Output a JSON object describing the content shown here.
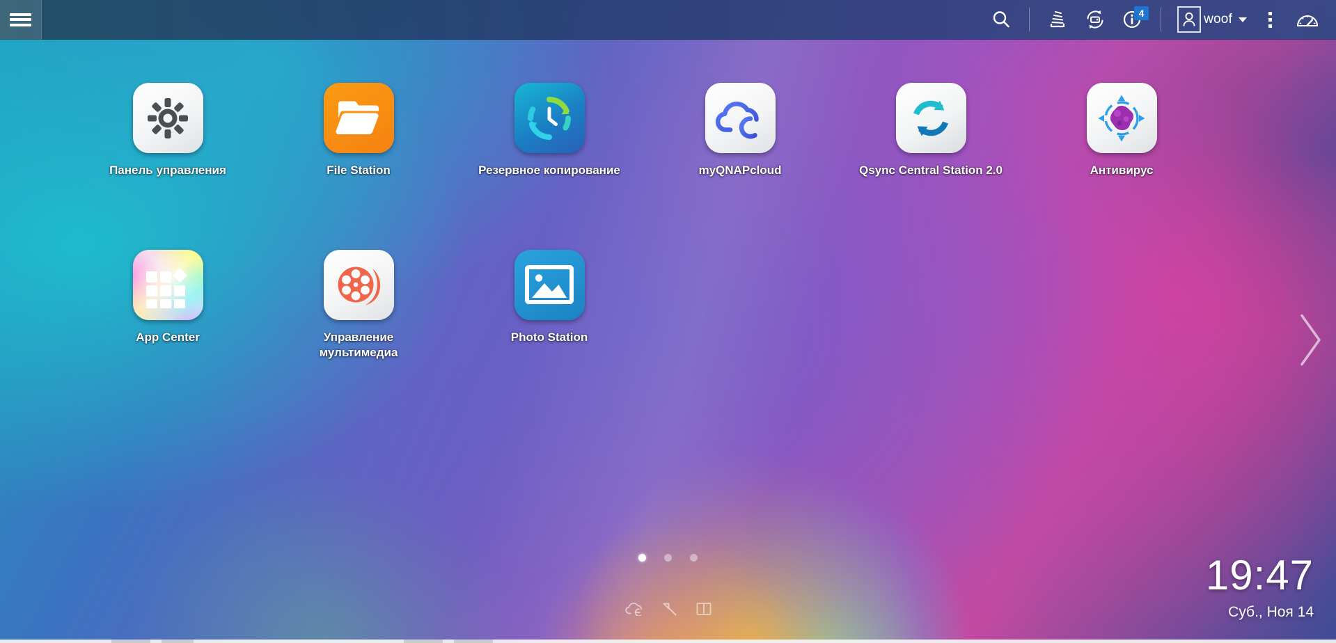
{
  "topbar": {
    "menu_icon": "hamburger-menu-icon",
    "search_icon": "search-icon",
    "resource_monitor_icon": "resource-monitor-icon",
    "background_tasks_icon": "background-tasks-sync-icon",
    "notifications_icon": "info-notification-icon",
    "notifications_count": "4",
    "avatar_icon": "user-avatar-icon",
    "user_name": "woof",
    "user_caret_icon": "chevron-down-icon",
    "more_icon": "more-options-vertical-dots-icon",
    "dashboard_icon": "dashboard-gauge-icon"
  },
  "desktop": {
    "apps": [
      {
        "label": "Панель управления",
        "icon": "control-panel-gear-icon"
      },
      {
        "label": "File Station",
        "icon": "file-station-folder-icon"
      },
      {
        "label": "Резервное копирование",
        "icon": "backup-station-clock-icon"
      },
      {
        "label": "myQNAPcloud",
        "icon": "myqnapcloud-cloud-icon"
      },
      {
        "label": "Qsync Central Station 2.0",
        "icon": "qsync-refresh-icon"
      },
      {
        "label": "Антивирус",
        "icon": "antivirus-target-icon"
      },
      {
        "label": "App Center",
        "icon": "app-center-grid-icon"
      },
      {
        "label": "Управление\nмультимедиа",
        "icon": "multimedia-film-reel-icon"
      },
      {
        "label": "Photo Station",
        "icon": "photo-station-image-icon"
      }
    ],
    "page_dots": {
      "total": 3,
      "active_index": 0
    },
    "next_page_icon": "chevron-right-icon"
  },
  "tray": {
    "items": [
      {
        "icon": "cloud-icon"
      },
      {
        "icon": "hammer-tools-icon"
      },
      {
        "icon": "book-manual-icon"
      }
    ]
  },
  "clock": {
    "time": "19:47",
    "date": "Суб., Ноя 14"
  },
  "colors": {
    "badge_blue": "#1d77d2",
    "topbar_blue": "#2b4470",
    "app_orange": "#f58212",
    "app_blue": "#1b82c4",
    "accent_cyan": "#18b7d4"
  }
}
